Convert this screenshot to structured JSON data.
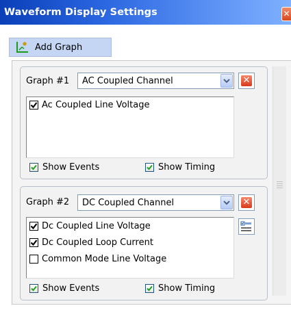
{
  "window": {
    "title": "Waveform Display Settings",
    "close_glyph": "✕"
  },
  "toolbar": {
    "add_graph_label": "Add Graph",
    "add_graph_icon": "chart-add-icon"
  },
  "graphs": [
    {
      "label": "Graph #1",
      "channel": "AC Coupled Channel",
      "signals": [
        {
          "label": "Ac Coupled Line Voltage",
          "checked": true
        }
      ],
      "show_events_label": "Show Events",
      "show_events": true,
      "show_timing_label": "Show Timing",
      "show_timing": true
    },
    {
      "label": "Graph #2",
      "channel": "DC Coupled Channel",
      "signals": [
        {
          "label": "Dc Coupled Line Voltage",
          "checked": true
        },
        {
          "label": "Dc Coupled Loop Current",
          "checked": true
        },
        {
          "label": "Common Mode Line Voltage",
          "checked": false
        }
      ],
      "show_events_label": "Show Events",
      "show_events": true,
      "show_timing_label": "Show Timing",
      "show_timing": true
    }
  ],
  "colors": {
    "title_bar_start": "#0a3fb8",
    "title_bar_end": "#7fb0ff",
    "delete_button": "#d8391c",
    "add_button_bg": "#c4d6f4"
  }
}
